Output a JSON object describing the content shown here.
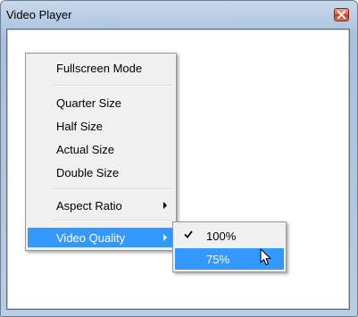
{
  "window": {
    "title": "Video Player"
  },
  "menu": {
    "items": [
      {
        "label": "Fullscreen Mode"
      },
      {
        "label": "Quarter Size"
      },
      {
        "label": "Half Size"
      },
      {
        "label": "Actual Size"
      },
      {
        "label": "Double Size"
      },
      {
        "label": "Aspect Ratio",
        "has_submenu": true
      },
      {
        "label": "Video Quality",
        "has_submenu": true,
        "highlighted": true
      }
    ]
  },
  "submenu": {
    "parent": "Video Quality",
    "items": [
      {
        "label": "100%",
        "checked": true
      },
      {
        "label": "75%",
        "highlighted": true
      }
    ]
  },
  "colors": {
    "highlight": "#3399ff",
    "menu_bg": "#f0f0f0",
    "close_button": "#c73a22"
  },
  "icons": [
    "close-icon",
    "submenu-arrow-icon",
    "check-icon",
    "mouse-pointer-icon"
  ]
}
